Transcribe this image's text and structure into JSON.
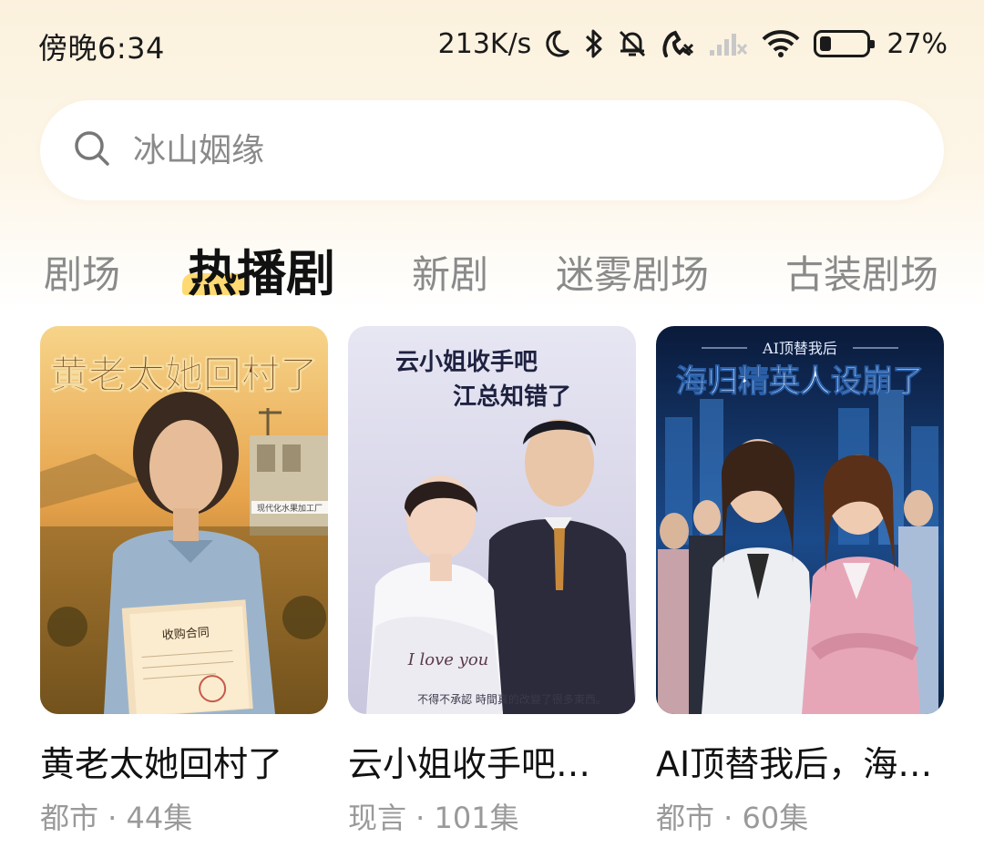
{
  "status_bar": {
    "time": "傍晚6:34",
    "net_speed": "213K/s",
    "battery_percent": "27%",
    "icons": [
      "moon-icon",
      "bluetooth-icon",
      "bell-muted-icon",
      "call-missed-icon",
      "signal-icon",
      "wifi-icon",
      "battery-icon"
    ]
  },
  "search": {
    "placeholder": "冰山姻缘",
    "icon": "search-icon"
  },
  "tabs": [
    {
      "label": "剧场",
      "active": false
    },
    {
      "label": "热播剧",
      "active": true
    },
    {
      "label": "新剧",
      "active": false
    },
    {
      "label": "迷雾剧场",
      "active": false
    },
    {
      "label": "古装剧场",
      "active": false
    }
  ],
  "dramas": [
    {
      "title": "黄老太她回村了",
      "meta": "都市 · 44集",
      "poster_title": "黄老太她回村了",
      "poster_caption": "收购合同",
      "poster_sign": "现代化水果加工厂"
    },
    {
      "title": "云小姐收手吧…",
      "meta": "现言 · 101集",
      "poster_title_line1": "云小姐收手吧",
      "poster_title_line2": "江总知错了",
      "poster_script": "I love you",
      "poster_caption": "不得不承認 時間真的改變了很多東西。"
    },
    {
      "title": "AI顶替我后，海…",
      "meta": "都市 · 60集",
      "poster_subtitle": "AI顶替我后",
      "poster_title": "海归精英人设崩了"
    }
  ]
}
